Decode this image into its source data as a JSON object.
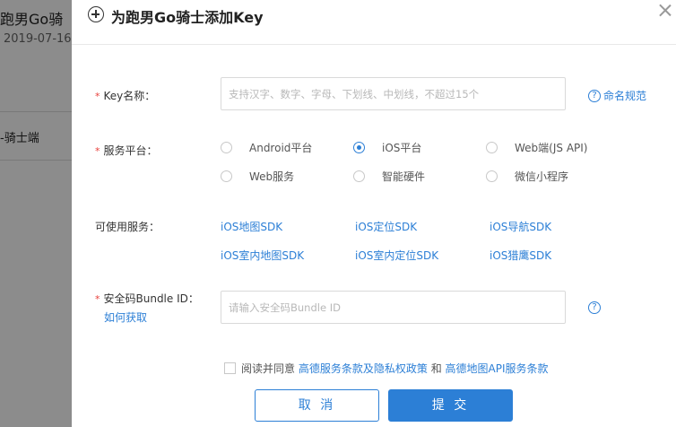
{
  "background": {
    "app_title": "跑男Go骑",
    "date": "2019-07-16",
    "item": "-骑士端"
  },
  "dialog": {
    "title": "为跑男Go骑士添加Key",
    "key_name": {
      "label": "Key名称：",
      "placeholder": "支持汉字、数字、字母、下划线、中划线，不超过15个",
      "value": "",
      "help": "命名规范"
    },
    "platform": {
      "label": "服务平台：",
      "options": [
        "Android平台",
        "iOS平台",
        "Web端(JS API)",
        "Web服务",
        "智能硬件",
        "微信小程序"
      ],
      "selected": "iOS平台"
    },
    "services": {
      "label": "可使用服务：",
      "items": [
        "iOS地图SDK",
        "iOS定位SDK",
        "iOS导航SDK",
        "iOS室内地图SDK",
        "iOS室内定位SDK",
        "iOS猎鹰SDK"
      ]
    },
    "bundle": {
      "label": "安全码Bundle ID：",
      "how_to": "如何获取",
      "placeholder": "请输入安全码Bundle ID",
      "value": ""
    },
    "agreement": {
      "prefix": "阅读并同意",
      "link1": "高德服务条款及隐私权政策",
      "and": "和",
      "link2": "高德地图API服务条款",
      "checked": false
    },
    "buttons": {
      "cancel": "取 消",
      "submit": "提 交"
    }
  },
  "colors": {
    "accent": "#2c7fd6",
    "required": "#e8403b",
    "overlay": "rgba(0,0,0,0.45)"
  },
  "icons": [
    "plus-circle-icon",
    "close-icon",
    "question-circle-icon"
  ]
}
